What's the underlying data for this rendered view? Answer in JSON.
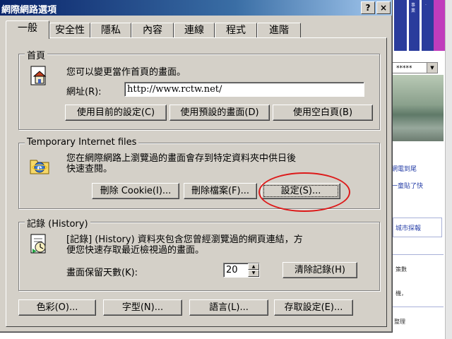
{
  "dialog": {
    "title": "網際網路選項",
    "help_label": "?",
    "close_label": "×"
  },
  "tabs": [
    {
      "label": "一般",
      "active": true
    },
    {
      "label": "安全性"
    },
    {
      "label": "隱私"
    },
    {
      "label": "內容"
    },
    {
      "label": "連線"
    },
    {
      "label": "程式"
    },
    {
      "label": "進階"
    }
  ],
  "home": {
    "group_title": "首頁",
    "description": "您可以變更當作首頁的畫面。",
    "address_label": "網址(R):",
    "address_value": "http://www.rctw.net/",
    "use_current_label": "使用目前的設定(C)",
    "use_default_label": "使用預設的畫面(D)",
    "use_blank_label": "使用空白頁(B)"
  },
  "temp_files": {
    "group_title": "Temporary Internet files",
    "description_line1": "您在網際網路上瀏覽過的畫面會存到特定資料夾中供日後",
    "description_line2": "快速查閱。",
    "delete_cookies_label": "刪除 Cookie(I)...",
    "delete_files_label": "刪除檔案(F)...",
    "settings_label": "設定(S)..."
  },
  "history": {
    "group_title": "記錄 (History)",
    "description_line1": "[記錄] (History) 資料夾包含您曾經瀏覽過的網頁連結，方",
    "description_line2": "便您快速存取最近檢視過的畫面。",
    "days_label": "畫面保留天數(K):",
    "days_value": "20",
    "clear_label": "清除記錄(H)"
  },
  "bottom_buttons": {
    "colors_label": "色彩(O)...",
    "fonts_label": "字型(N)...",
    "languages_label": "語言(L)...",
    "accessibility_label": "存取設定(E)..."
  },
  "background": {
    "banner_text_1": "事業",
    "banner_text_2": "·",
    "select_value": "*****",
    "link_1": "網電到尾",
    "link_2": "一童貼了快",
    "link_3": "城市探報",
    "small_1": "策數",
    "small_2": "機，",
    "small_3": "整理"
  },
  "colors": {
    "title_gradient_start": "#0a246a",
    "title_gradient_end": "#a6caf0",
    "face": "#d4d0c8",
    "annotation": "#dd1a1a"
  }
}
